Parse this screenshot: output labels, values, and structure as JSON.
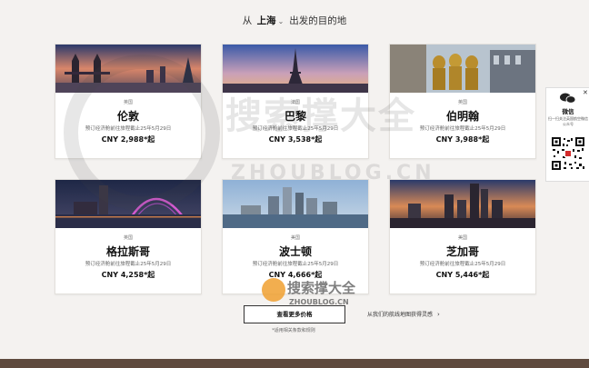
{
  "header": {
    "prefix": "从",
    "city": "上海",
    "suffix": "出发的目的地"
  },
  "cards": [
    {
      "country": "英国",
      "city": "伦敦",
      "note": "预订经济舱前往旅程截止25年5月29日",
      "price": "CNY 2,988*起"
    },
    {
      "country": "法国",
      "city": "巴黎",
      "note": "预订经济舱前往旅程截止25年5月29日",
      "price": "CNY 3,538*起"
    },
    {
      "country": "英国",
      "city": "伯明翰",
      "note": "预订经济舱前往旅程截止25年5月29日",
      "price": "CNY 3,988*起"
    },
    {
      "country": "英国",
      "city": "格拉斯哥",
      "note": "预订经济舱前往旅程截止25年5月29日",
      "price": "CNY 4,258*起"
    },
    {
      "country": "美国",
      "city": "波士顿",
      "note": "预订经济舱前往旅程截止25年5月29日",
      "price": "CNY 4,666*起"
    },
    {
      "country": "美国",
      "city": "芝加哥",
      "note": "预订经济舱前往旅程截止25年5月29日",
      "price": "CNY 5,446*起"
    }
  ],
  "more_button": "查看更多价格",
  "disclaimer": "*适用相关条款和规则",
  "hub_link": "从我们的航线地图获得灵感",
  "wechat": {
    "title": "微信",
    "desc": "扫一扫关注英国航空微信公众号"
  },
  "watermark": {
    "cn": "搜索撑大全",
    "en": "ZHOUBLOG.CN"
  },
  "colors": {
    "bottom_bar": "#5f4a3e",
    "page_bg": "#f4f2f0"
  }
}
